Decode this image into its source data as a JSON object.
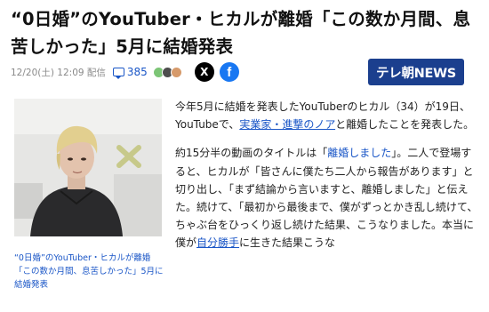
{
  "headline": "“0日婚”のYouTuber・ヒカルが離婚「この数か月間、息苦しかった」5月に結婚発表",
  "meta": {
    "date": "12/20(土) 12:09 配信",
    "comment_count": "385",
    "share_x_label": "X",
    "share_fb_label": "f"
  },
  "source": {
    "logo_text": "テレ朝NEWS"
  },
  "figure": {
    "caption": "“0日婚”のYouTuber・ヒカルが離婚「この数か月間、息苦しかった」5月に結婚発表"
  },
  "article": {
    "p1": {
      "before": "今年5月に結婚を発表したYouTuberのヒカル（34）が19日、YouTubeで、",
      "link": "実業家・進撃のノア",
      "after": "と離婚したことを発表した。"
    },
    "p2": {
      "before": "約15分半の動画のタイトルは「",
      "link": "離婚しました",
      "mid": "」。二人で登場すると、ヒカルが「皆さんに僕たち二人から報告があります」と切り出し、「まず結論から言いますと、離婚しました」と伝えた。続けて、「最初から最後まで、僕がずっとかき乱し続けて、ちゃぶ台をひっくり返し続けた結果、こうなりました。本当に僕が",
      "link2": "自分勝手",
      "after": "に生きた結果こうな"
    }
  },
  "colors": {
    "link": "#1a56c7",
    "logo_bg": "#1b3f8e",
    "facebook": "#1877f2"
  }
}
